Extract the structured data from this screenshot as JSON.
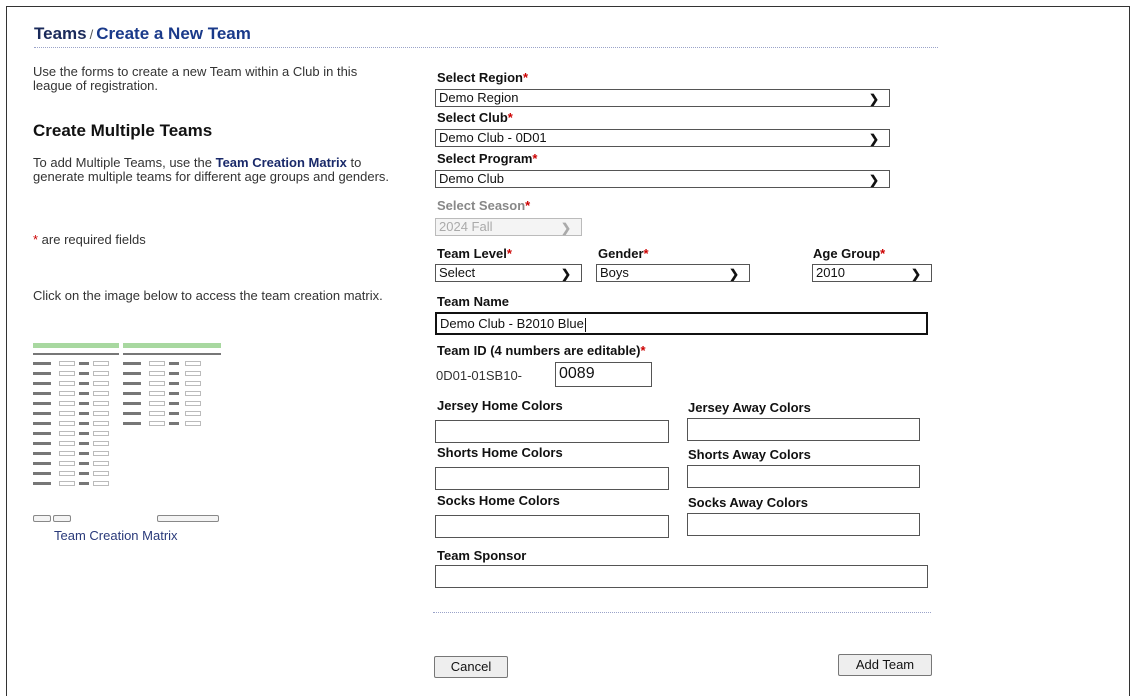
{
  "breadcrumb": {
    "root": "Teams",
    "separator": "/",
    "current": "Create a New Team"
  },
  "intro": "Use the forms to create a new Team within a Club in this league of registration.",
  "multi": {
    "heading": "Create Multiple Teams",
    "text_before": "To add Multiple Teams, use the ",
    "link": "Team Creation Matrix",
    "text_after": " to generate multiple teams for different age groups and genders."
  },
  "required_note": {
    "star": "*",
    "text": " are required fields"
  },
  "matrix_instruction": "Click on the image below to access the team creation matrix.",
  "matrix_caption": "Team Creation Matrix",
  "form": {
    "region": {
      "label": "Select Region",
      "star": "*",
      "value": "Demo Region"
    },
    "club": {
      "label": "Select Club",
      "star": "*",
      "value": "Demo Club - 0D01"
    },
    "program": {
      "label": "Select Program",
      "star": "*",
      "value": "Demo Club"
    },
    "season": {
      "label": "Select Season",
      "star": "*",
      "value": "2024 Fall"
    },
    "team_level": {
      "label": "Team Level",
      "star": "*",
      "value": "Select"
    },
    "gender": {
      "label": "Gender",
      "star": "*",
      "value": "Boys"
    },
    "age_group": {
      "label": "Age Group",
      "star": "*",
      "value": "2010"
    },
    "team_name": {
      "label": "Team Name",
      "value": "Demo Club - B2010 Blue"
    },
    "team_id": {
      "label": "Team ID (4 numbers are editable)",
      "star": "*",
      "prefix": "0D01-01SB10-",
      "value": "0089"
    },
    "jersey_home": {
      "label": "Jersey Home Colors",
      "value": ""
    },
    "jersey_away": {
      "label": "Jersey Away Colors",
      "value": ""
    },
    "shorts_home": {
      "label": "Shorts Home Colors",
      "value": ""
    },
    "shorts_away": {
      "label": "Shorts Away Colors",
      "value": ""
    },
    "socks_home": {
      "label": "Socks Home Colors",
      "value": ""
    },
    "socks_away": {
      "label": "Socks Away Colors",
      "value": ""
    },
    "sponsor": {
      "label": "Team Sponsor",
      "value": ""
    }
  },
  "buttons": {
    "cancel": "Cancel",
    "add": "Add Team"
  },
  "icons": {
    "dropdown": "chevron-down-icon"
  },
  "colors": {
    "title": "#1a2a5a",
    "required": "#cc0000",
    "link": "#1a2a6a"
  }
}
